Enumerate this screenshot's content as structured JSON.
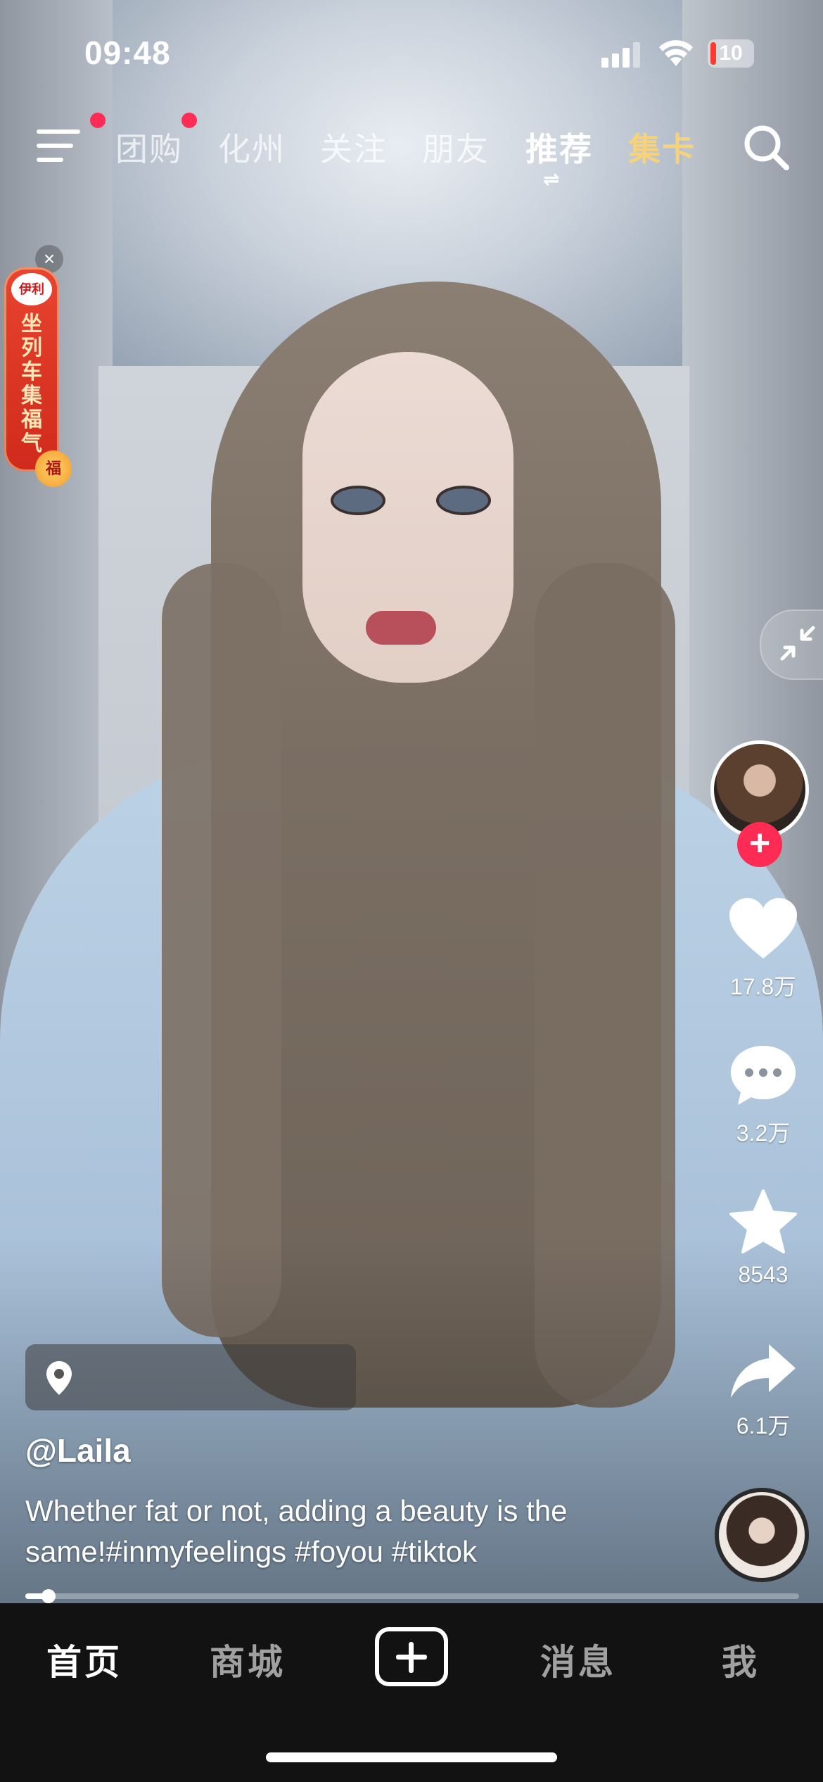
{
  "status_bar": {
    "time": "09:48",
    "battery": "10",
    "battery_color": "#ff3b30"
  },
  "top_nav": {
    "menu_icon": "menu-icon",
    "tabs": [
      {
        "label": "团购",
        "has_dot": true
      },
      {
        "label": "化州",
        "has_dot": false
      },
      {
        "label": "关注",
        "has_dot": false
      },
      {
        "label": "朋友",
        "has_dot": false
      },
      {
        "label": "推荐",
        "active": true
      },
      {
        "label": "集卡",
        "highlight_color": "#f6d27a"
      }
    ],
    "active_tab_indicator": "⇌",
    "search_icon": "search-icon",
    "dot_color": "#ff2d55"
  },
  "promo": {
    "logo": "伊利",
    "text": "坐列车集福气",
    "badge": "福",
    "close": "×"
  },
  "actions": {
    "follow_plus": "+",
    "like_count": "17.8万",
    "comment_count": "3.2万",
    "favorite_count": "8543",
    "share_count": "6.1万",
    "accent_color": "#fe2c55"
  },
  "post": {
    "location": "",
    "username": "@Laila",
    "caption": "Whether fat or not, adding a beauty is the same!#inmyfeelings #foyou #tiktok",
    "progress": 0.03
  },
  "bottom_nav": {
    "items": [
      "首页",
      "商城",
      "消息",
      "我"
    ],
    "create_icon": "plus-icon"
  }
}
